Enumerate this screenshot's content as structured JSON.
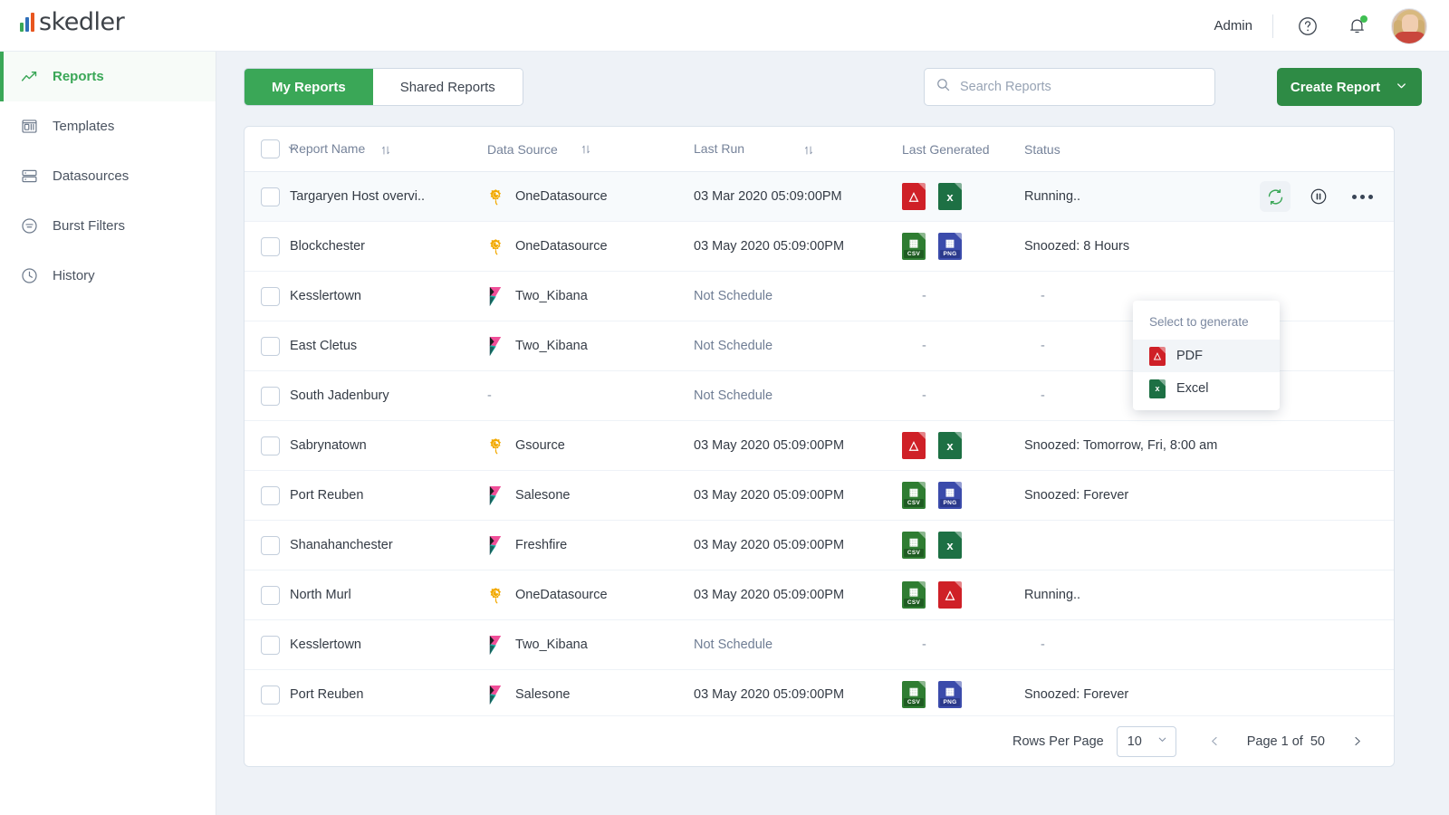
{
  "brand": {
    "name": "skedler"
  },
  "header": {
    "user_label": "Admin",
    "help_icon": "question-circle-icon",
    "notification_icon": "bell-icon",
    "avatar_icon": "user-avatar"
  },
  "sidebar": {
    "items": [
      {
        "label": "Reports",
        "icon": "trend-line-icon",
        "active": true
      },
      {
        "label": "Templates",
        "icon": "layout-icon",
        "active": false
      },
      {
        "label": "Datasources",
        "icon": "database-icon",
        "active": false
      },
      {
        "label": "Burst Filters",
        "icon": "filter-icon",
        "active": false
      },
      {
        "label": "History",
        "icon": "clock-icon",
        "active": false
      }
    ]
  },
  "toolbar": {
    "tabs": [
      {
        "label": "My Reports",
        "active": true
      },
      {
        "label": "Shared Reports",
        "active": false
      }
    ],
    "search": {
      "placeholder": "Search Reports",
      "value": "",
      "icon": "search-icon"
    },
    "create_button": {
      "label": "Create Report",
      "icon": "chevron-down-icon"
    }
  },
  "table": {
    "columns": [
      {
        "label": "Report Name",
        "sortable": true
      },
      {
        "label": "Data Source",
        "sortable": true
      },
      {
        "label": "Last Run",
        "sortable": true
      },
      {
        "label": "Last Generated",
        "sortable": false
      },
      {
        "label": "Status",
        "sortable": false
      }
    ],
    "rows": [
      {
        "name": "Targaryen Host overvi..",
        "source": "OneDatasource",
        "source_icon": "grafana-icon",
        "last_run": "03 Mar 2020 05:09:00PM",
        "scheduled": true,
        "generated": [
          "pdf",
          "excel"
        ],
        "status": "Running..",
        "highlight": true
      },
      {
        "name": "Blockchester",
        "source": "OneDatasource",
        "source_icon": "grafana-icon",
        "last_run": "03 May 2020 05:09:00PM",
        "scheduled": true,
        "generated": [
          "csv",
          "png"
        ],
        "status": "Snoozed: 8 Hours",
        "highlight": false
      },
      {
        "name": "Kesslertown",
        "source": "Two_Kibana",
        "source_icon": "kibana-icon",
        "last_run": "Not Schedule",
        "scheduled": false,
        "generated": [],
        "status": "-",
        "highlight": false
      },
      {
        "name": "East Cletus",
        "source": "Two_Kibana",
        "source_icon": "kibana-icon",
        "last_run": "Not Schedule",
        "scheduled": false,
        "generated": [],
        "status": "-",
        "highlight": false
      },
      {
        "name": "South Jadenbury",
        "source": "-",
        "source_icon": "none",
        "last_run": "Not Schedule",
        "scheduled": false,
        "generated": [],
        "status": "-",
        "highlight": false
      },
      {
        "name": "Sabrynatown",
        "source": "Gsource",
        "source_icon": "grafana-icon",
        "last_run": "03 May 2020 05:09:00PM",
        "scheduled": true,
        "generated": [
          "pdf",
          "excel"
        ],
        "status": "Snoozed: Tomorrow, Fri, 8:00 am",
        "highlight": false
      },
      {
        "name": "Port Reuben",
        "source": "Salesone",
        "source_icon": "kibana-icon",
        "last_run": "03 May 2020 05:09:00PM",
        "scheduled": true,
        "generated": [
          "csv",
          "png"
        ],
        "status": "Snoozed: Forever",
        "highlight": false
      },
      {
        "name": "Shanahanchester",
        "source": "Freshfire",
        "source_icon": "kibana-icon",
        "last_run": "03 May 2020 05:09:00PM",
        "scheduled": true,
        "generated": [
          "csv",
          "excel"
        ],
        "status": "",
        "highlight": false
      },
      {
        "name": "North Murl",
        "source": "OneDatasource",
        "source_icon": "grafana-icon",
        "last_run": "03 May 2020 05:09:00PM",
        "scheduled": true,
        "generated": [
          "csv",
          "pdf"
        ],
        "status": "Running..",
        "highlight": false
      },
      {
        "name": "Kesslertown",
        "source": "Two_Kibana",
        "source_icon": "kibana-icon",
        "last_run": "Not Schedule",
        "scheduled": false,
        "generated": [],
        "status": "-",
        "highlight": false
      },
      {
        "name": "Port Reuben",
        "source": "Salesone",
        "source_icon": "kibana-icon",
        "last_run": "03 May 2020 05:09:00PM",
        "scheduled": true,
        "generated": [
          "csv",
          "png"
        ],
        "status": "Snoozed: Forever",
        "highlight": false
      }
    ],
    "row_actions": {
      "regenerate": "regenerate-icon",
      "pause": "pause-icon",
      "more": "more-options-icon"
    }
  },
  "dropdown": {
    "title": "Select to generate",
    "items": [
      {
        "label": "PDF",
        "icon": "pdf-file-icon",
        "selected": true
      },
      {
        "label": "Excel",
        "icon": "excel-file-icon",
        "selected": false
      }
    ]
  },
  "footer": {
    "rows_per_page_label": "Rows Per Page",
    "rows_per_page_value": "10",
    "page_text": "Page 1 of  50",
    "prev_icon": "chevron-left-icon",
    "next_icon": "chevron-right-icon"
  },
  "colors": {
    "brand_green": "#3aa757",
    "button_green": "#2e8b45",
    "pdf_red": "#cf2027",
    "excel_green": "#1d7044",
    "csv_green": "#2f7d32",
    "png_blue": "#3b4bab",
    "grafana_orange": "#f2a900",
    "kibana_pink": "#f04e98"
  }
}
